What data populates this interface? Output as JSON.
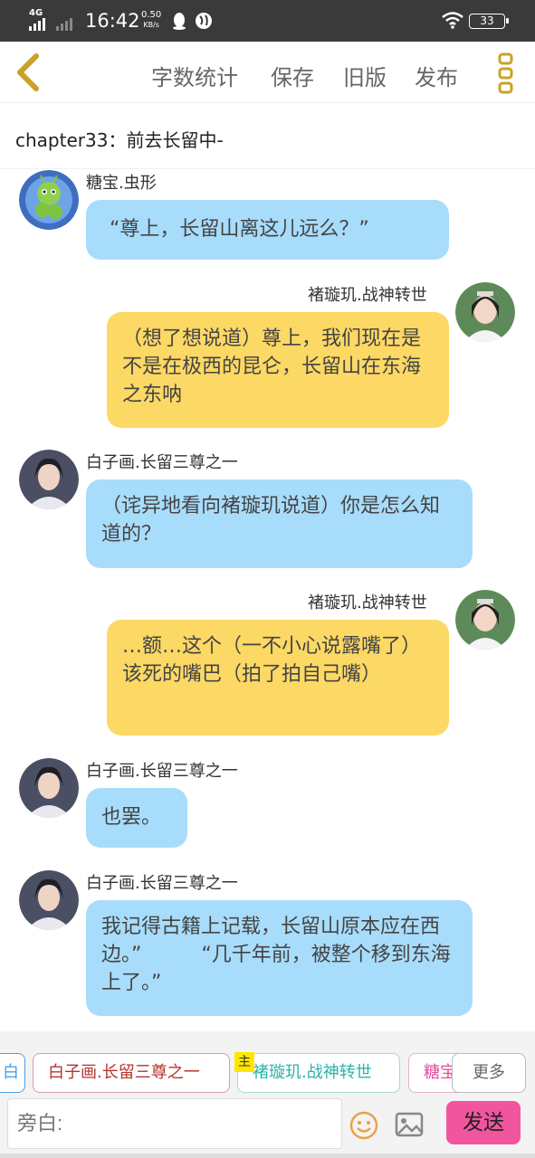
{
  "status_bar": {
    "network": "4G",
    "time": "16:42",
    "speed_value": "0.50",
    "speed_unit": "KB/s",
    "battery": "33"
  },
  "toolbar": {
    "word_count": "字数统计",
    "save": "保存",
    "old_version": "旧版",
    "publish": "发布"
  },
  "chapter": {
    "title": "chapter33：前去长留中-"
  },
  "messages": [
    {
      "side": "left",
      "name": "糖宝.虫形",
      "text": "“尊上，长留山离这儿远么？”",
      "color": "blue"
    },
    {
      "side": "right",
      "name": "褚璇玑.战神转世",
      "text": "（想了想说道）尊上，我们现在是不是在极西的昆仑，长留山在东海之东呐",
      "color": "yellow"
    },
    {
      "side": "left",
      "name": "白子画.长留三尊之一",
      "text": "（诧异地看向褚璇玑说道）你是怎么知道的？",
      "color": "blue"
    },
    {
      "side": "right",
      "name": "褚璇玑.战神转世",
      "text": "…额…这个（一不小心说露嘴了）该死的嘴巴（拍了拍自己嘴）",
      "color": "yellow"
    },
    {
      "side": "left",
      "name": "白子画.长留三尊之一",
      "text": "也罢。",
      "color": "blue"
    },
    {
      "side": "left",
      "name": "白子画.长留三尊之一",
      "text": "我记得古籍上记载，长留山原本应在西边。”　　　“几千年前，被整个移到东海上了。”",
      "color": "blue"
    }
  ],
  "role_chips": {
    "narrator_partial": "白",
    "bai": "白子画.长留三尊之一",
    "zhu_tag": "主",
    "chu": "褚璇玑.战神转世",
    "tang": "糖宝",
    "more": "更多"
  },
  "input": {
    "placeholder": "旁白:"
  },
  "send_label": "发送",
  "colors": {
    "blue_bubble": "#a8dcfb",
    "yellow_bubble": "#fcd865",
    "send_button": "#f1559e",
    "accent_gold": "#c9a227"
  }
}
